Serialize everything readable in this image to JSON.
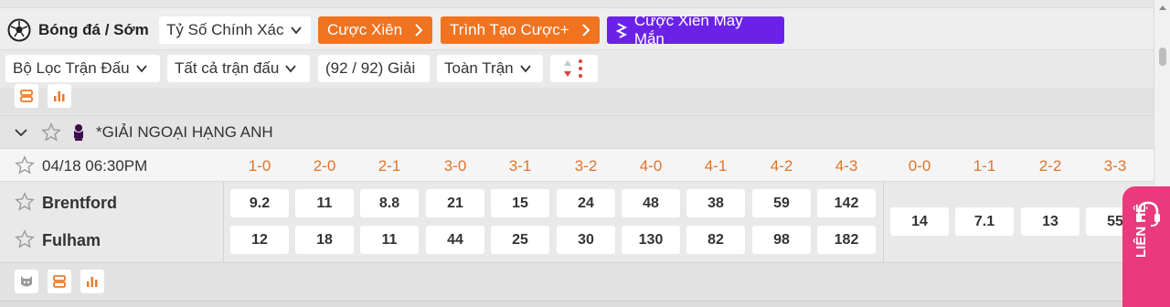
{
  "topbar": {
    "sport_label": "Bóng đá / Sớm",
    "bet_type": "Tỷ Số Chính Xác",
    "buttons": [
      {
        "label": "Cược Xiên"
      },
      {
        "label": "Trình Tạo Cược+"
      },
      {
        "label": "Cược Xiên May Mắn"
      }
    ]
  },
  "filters": {
    "match_filter": "Bộ Lọc Trận Đấu",
    "all_matches": "Tất cả trận đấu",
    "leagues": "(92 / 92) Giải",
    "period": "Toàn Trận"
  },
  "league": {
    "name": "*GIẢI NGOẠI HẠNG ANH"
  },
  "match": {
    "time": "04/18 06:30PM",
    "home": "Brentford",
    "away": "Fulham",
    "score_headers": [
      "1-0",
      "2-0",
      "2-1",
      "3-0",
      "3-1",
      "3-2",
      "4-0",
      "4-1",
      "4-2",
      "4-3",
      "0-0",
      "1-1",
      "2-2",
      "3-3"
    ],
    "home_odds": [
      "9.2",
      "11",
      "8.8",
      "21",
      "15",
      "24",
      "48",
      "38",
      "59",
      "142"
    ],
    "away_odds": [
      "12",
      "18",
      "11",
      "44",
      "25",
      "30",
      "130",
      "82",
      "98",
      "182"
    ],
    "draw_odds": [
      "14",
      "7.1",
      "13",
      "55"
    ]
  },
  "contact": {
    "label": "LIÊN HỆ"
  },
  "colors": {
    "accent_orange": "#f07320",
    "purple": "#6a22e8",
    "header_orange": "#e0752a",
    "contact_pink": "#e83a7c"
  }
}
